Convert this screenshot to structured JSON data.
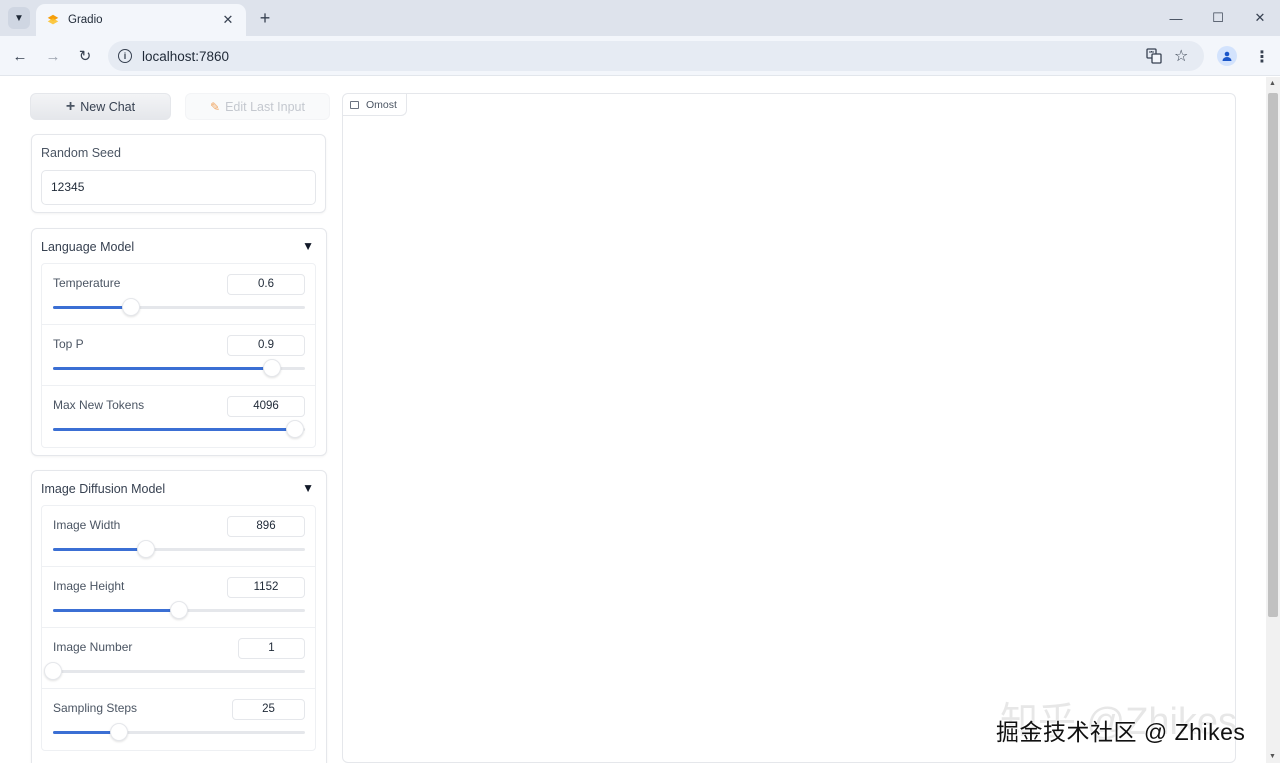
{
  "browser": {
    "tab_title": "Gradio",
    "url": "localhost:7860"
  },
  "app": {
    "new_chat_label": "New Chat",
    "edit_last_input_label": "Edit Last Input",
    "random_seed": {
      "label": "Random Seed",
      "value": "12345"
    },
    "language_model": {
      "title": "Language Model",
      "caret": "▼",
      "sliders": [
        {
          "label": "Temperature",
          "value": "0.6",
          "fraction": 0.31
        },
        {
          "label": "Top P",
          "value": "0.9",
          "fraction": 0.87
        },
        {
          "label": "Max New Tokens",
          "value": "4096",
          "fraction": 0.96
        }
      ]
    },
    "image_diffusion_model": {
      "title": "Image Diffusion Model",
      "caret": "▼",
      "sliders": [
        {
          "label": "Image Width",
          "value": "896",
          "fraction": 0.37
        },
        {
          "label": "Image Height",
          "value": "1152",
          "fraction": 0.5
        },
        {
          "label": "Image Number",
          "value": "1",
          "fraction": 0.0
        },
        {
          "label": "Sampling Steps",
          "value": "25",
          "fraction": 0.26
        }
      ]
    },
    "chatbot_label": "Omost"
  },
  "watermark": {
    "text": "掘金技术社区 @ Zhikes",
    "faint_text": "知乎 @Zhikes"
  },
  "colors": {
    "accent": "#3b6fd4",
    "tabstrip": "#dee3ec"
  },
  "icons": {
    "new_chat": "plus-icon",
    "edit": "pencil-icon",
    "chatbot": "chat-icon"
  }
}
